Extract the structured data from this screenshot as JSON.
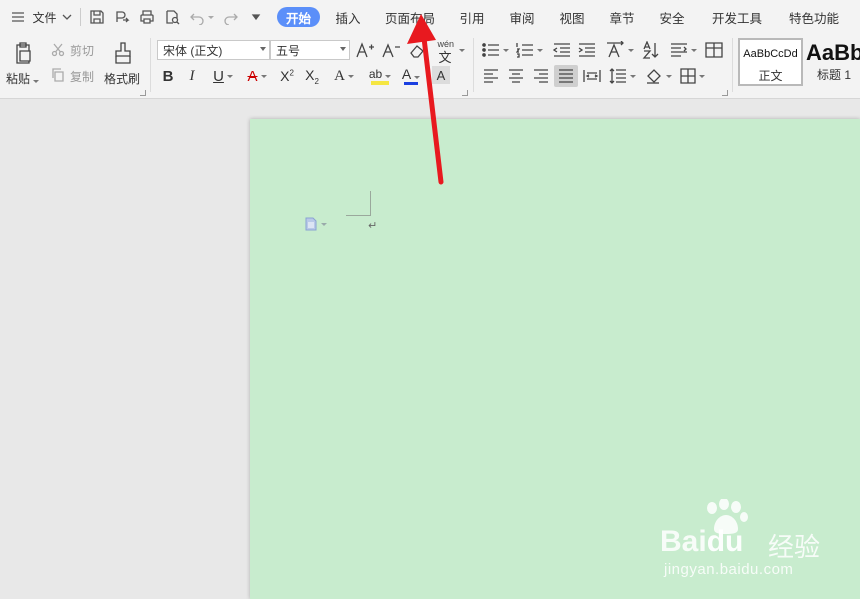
{
  "menu": {
    "file_label": "文件"
  },
  "tabs": [
    {
      "label": "开始"
    },
    {
      "label": "插入"
    },
    {
      "label": "页面布局"
    },
    {
      "label": "引用"
    },
    {
      "label": "审阅"
    },
    {
      "label": "视图"
    },
    {
      "label": "章节"
    },
    {
      "label": "安全"
    },
    {
      "label": "开发工具"
    },
    {
      "label": "特色功能"
    }
  ],
  "clipboard": {
    "paste": "粘贴",
    "cut": "剪切",
    "copy": "复制",
    "format_painter": "格式刷"
  },
  "font": {
    "name": "宋体 (正文)",
    "size": "五号",
    "pinyin": "wén"
  },
  "styles": [
    {
      "preview": "AaBbCcDd",
      "name": "正文"
    },
    {
      "preview": "AaBb",
      "name": "标题 1"
    }
  ],
  "document": {
    "paragraph_mark": "↵"
  },
  "watermark": {
    "brand": "Bai",
    "brand2": "du",
    "text": "经验",
    "url": "jingyan.baidu.com"
  },
  "colors": {
    "accent": "#5b8ff9",
    "page_bg": "#c8ecce",
    "arrow": "#e8191f",
    "font_color": "#1a3fe0",
    "highlight": "#f5e642"
  }
}
